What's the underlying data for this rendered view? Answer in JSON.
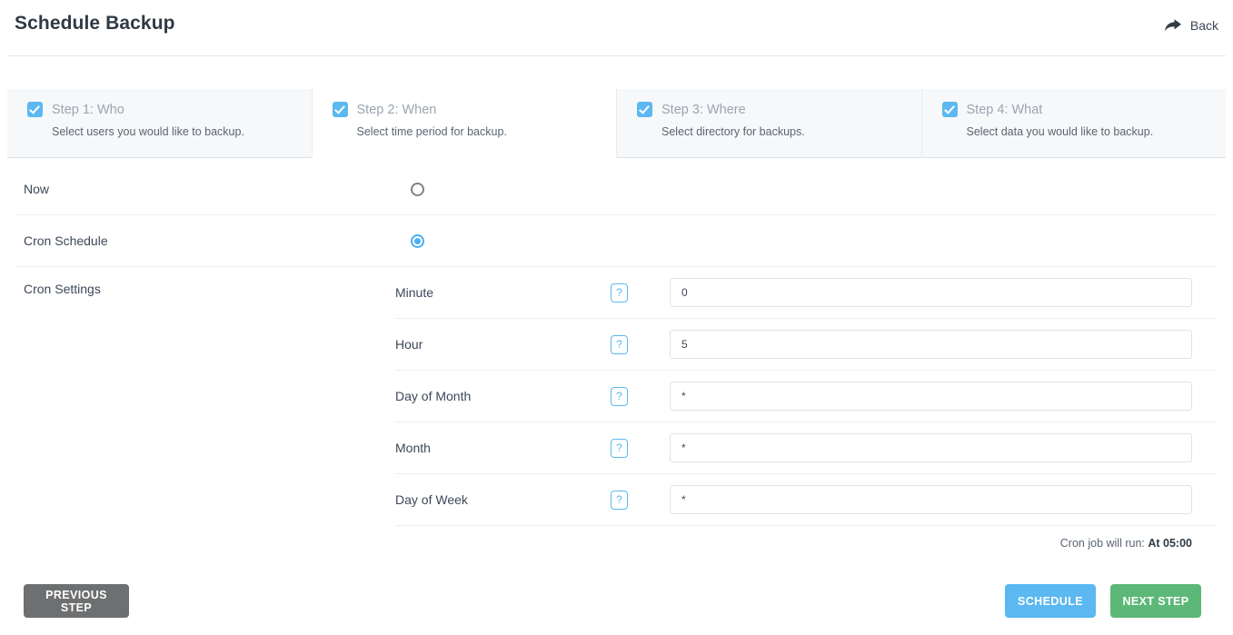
{
  "header": {
    "title": "Schedule Backup",
    "back_label": "Back",
    "back_icon": "forward-arrow-icon"
  },
  "steps": [
    {
      "title": "Step 1: Who",
      "desc": "Select users you would like to backup.",
      "checked": true,
      "active": false
    },
    {
      "title": "Step 2: When",
      "desc": "Select time period for backup.",
      "checked": true,
      "active": true
    },
    {
      "title": "Step 3: Where",
      "desc": "Select directory for backups.",
      "checked": true,
      "active": false
    },
    {
      "title": "Step 4: What",
      "desc": "Select data you would like to backup.",
      "checked": true,
      "active": false
    }
  ],
  "schedule_type": {
    "now_label": "Now",
    "now_selected": false,
    "cron_label": "Cron Schedule",
    "cron_selected": true
  },
  "cron_settings": {
    "section_label": "Cron Settings",
    "help_glyph": "?",
    "fields": [
      {
        "label": "Minute",
        "value": "0"
      },
      {
        "label": "Hour",
        "value": "5"
      },
      {
        "label": "Day of Month",
        "value": "*"
      },
      {
        "label": "Month",
        "value": "*"
      },
      {
        "label": "Day of Week",
        "value": "*"
      }
    ],
    "summary_prefix": "Cron job will run:",
    "summary_value": "At 05:00"
  },
  "footer": {
    "previous_label": "PREVIOUS STEP",
    "schedule_label": "SCHEDULE",
    "next_label": "NEXT STEP"
  },
  "colors": {
    "accent_blue": "#5bb8f0",
    "green": "#5cb878",
    "gray": "#6d6f70"
  }
}
